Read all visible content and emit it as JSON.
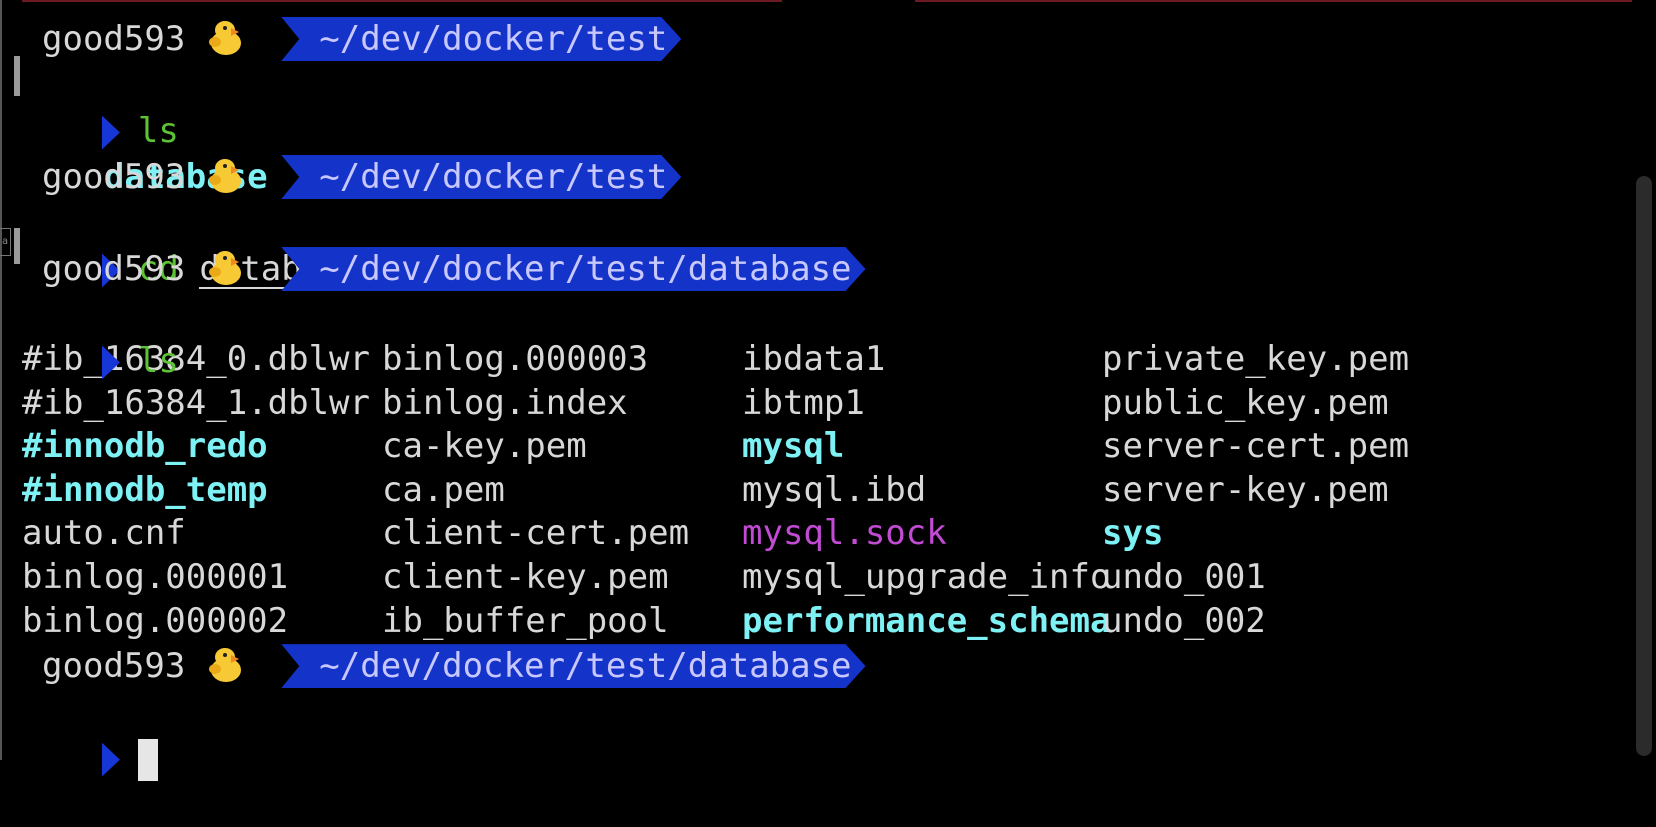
{
  "colors": {
    "background": "#000000",
    "text": "#d8d8d8",
    "path_segment": "#1433c9",
    "command": "#5ec237",
    "directory": "#7ef1f5",
    "socket": "#c24bd4"
  },
  "prompts": [
    {
      "user": "good593",
      "emoji": "chick-icon",
      "path": "~/dev/docker/test"
    },
    {
      "user": "good593",
      "emoji": "chick-icon",
      "path": "~/dev/docker/test"
    },
    {
      "user": "good593",
      "emoji": "chick-icon",
      "path": "~/dev/docker/test/database"
    },
    {
      "user": "good593",
      "emoji": "chick-icon",
      "path": "~/dev/docker/test/database"
    }
  ],
  "commands": [
    {
      "cmd": "ls",
      "arg": ""
    },
    {
      "cmd": "cd",
      "arg": "database"
    },
    {
      "cmd": "ls",
      "arg": ""
    }
  ],
  "first_ls_output": "database",
  "listing": [
    {
      "name": "#ib_16384_0.dblwr",
      "type": "file"
    },
    {
      "name": "#ib_16384_1.dblwr",
      "type": "file"
    },
    {
      "name": "#innodb_redo",
      "type": "dir"
    },
    {
      "name": "#innodb_temp",
      "type": "dir"
    },
    {
      "name": "auto.cnf",
      "type": "file"
    },
    {
      "name": "binlog.000001",
      "type": "file"
    },
    {
      "name": "binlog.000002",
      "type": "file"
    },
    {
      "name": "binlog.000003",
      "type": "file"
    },
    {
      "name": "binlog.index",
      "type": "file"
    },
    {
      "name": "ca-key.pem",
      "type": "file"
    },
    {
      "name": "ca.pem",
      "type": "file"
    },
    {
      "name": "client-cert.pem",
      "type": "file"
    },
    {
      "name": "client-key.pem",
      "type": "file"
    },
    {
      "name": "ib_buffer_pool",
      "type": "file"
    },
    {
      "name": "ibdata1",
      "type": "file"
    },
    {
      "name": "ibtmp1",
      "type": "file"
    },
    {
      "name": "mysql",
      "type": "dir"
    },
    {
      "name": "mysql.ibd",
      "type": "file"
    },
    {
      "name": "mysql.sock",
      "type": "socket"
    },
    {
      "name": "mysql_upgrade_info",
      "type": "file"
    },
    {
      "name": "performance_schema",
      "type": "dir"
    },
    {
      "name": "private_key.pem",
      "type": "file"
    },
    {
      "name": "public_key.pem",
      "type": "file"
    },
    {
      "name": "server-cert.pem",
      "type": "file"
    },
    {
      "name": "server-key.pem",
      "type": "file"
    },
    {
      "name": "sys",
      "type": "dir"
    },
    {
      "name": "undo_001",
      "type": "file"
    },
    {
      "name": "undo_002",
      "type": "file"
    }
  ]
}
